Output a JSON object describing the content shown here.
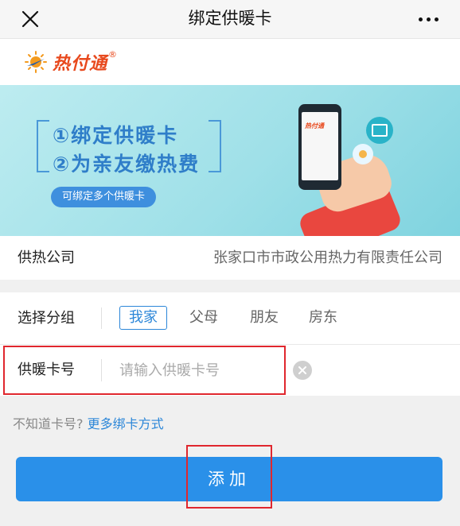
{
  "header": {
    "title": "绑定供暖卡"
  },
  "brand": {
    "name": "热付通",
    "mark": "®",
    "accent": "#e8491d"
  },
  "banner": {
    "line1": "①绑定供暖卡",
    "line2": "②为亲友缴热费",
    "pill": "可绑定多个供暖卡",
    "phone_logo": "热付通"
  },
  "company": {
    "label": "供热公司",
    "value": "张家口市市政公用热力有限责任公司"
  },
  "group": {
    "label": "选择分组",
    "options": [
      "我家",
      "父母",
      "朋友",
      "房东"
    ],
    "selected": "我家"
  },
  "card": {
    "label": "供暖卡号",
    "placeholder": "请输入供暖卡号",
    "value": ""
  },
  "hint": {
    "text": "不知道卡号?",
    "link": "更多绑卡方式"
  },
  "submit": {
    "label": "添加"
  },
  "colors": {
    "primary": "#2a90e9",
    "highlight": "#e0272e"
  }
}
